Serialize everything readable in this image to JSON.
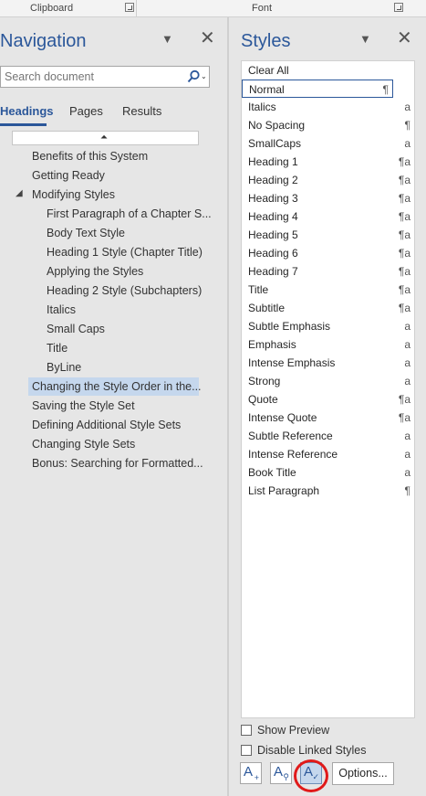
{
  "ribbon": {
    "clipboard_label": "Clipboard",
    "font_label": "Font"
  },
  "navigation": {
    "title": "Navigation",
    "search": {
      "placeholder": "Search document",
      "value": ""
    },
    "tabs": [
      {
        "label": "Headings"
      },
      {
        "label": "Pages"
      },
      {
        "label": "Results"
      }
    ],
    "headings": [
      {
        "label": "Benefits of this System"
      },
      {
        "label": "Getting Ready"
      },
      {
        "label": "Modifying Styles"
      },
      {
        "label": "First Paragraph of a Chapter S..."
      },
      {
        "label": "Body Text Style"
      },
      {
        "label": "Heading 1 Style (Chapter Title)"
      },
      {
        "label": "Applying the Styles"
      },
      {
        "label": "Heading 2 Style (Subchapters)"
      },
      {
        "label": "Italics"
      },
      {
        "label": "Small Caps"
      },
      {
        "label": "Title"
      },
      {
        "label": "ByLine"
      },
      {
        "label": "Changing the Style Order in the..."
      },
      {
        "label": "Saving the Style Set"
      },
      {
        "label": "Defining Additional Style Sets"
      },
      {
        "label": "Changing Style Sets"
      },
      {
        "label": "Bonus: Searching for Formatted..."
      }
    ]
  },
  "styles": {
    "title": "Styles",
    "items": [
      {
        "name": "Clear All",
        "type": ""
      },
      {
        "name": "Normal",
        "type": "¶"
      },
      {
        "name": "Italics",
        "type": "a"
      },
      {
        "name": "No Spacing",
        "type": "¶"
      },
      {
        "name": "SmallCaps",
        "type": "a"
      },
      {
        "name": "Heading 1",
        "type": "¶a"
      },
      {
        "name": "Heading 2",
        "type": "¶a"
      },
      {
        "name": "Heading 3",
        "type": "¶a"
      },
      {
        "name": "Heading 4",
        "type": "¶a"
      },
      {
        "name": "Heading 5",
        "type": "¶a"
      },
      {
        "name": "Heading 6",
        "type": "¶a"
      },
      {
        "name": "Heading 7",
        "type": "¶a"
      },
      {
        "name": "Title",
        "type": "¶a"
      },
      {
        "name": "Subtitle",
        "type": "¶a"
      },
      {
        "name": "Subtle Emphasis",
        "type": "a"
      },
      {
        "name": "Emphasis",
        "type": "a"
      },
      {
        "name": "Intense Emphasis",
        "type": "a"
      },
      {
        "name": "Strong",
        "type": "a"
      },
      {
        "name": "Quote",
        "type": "¶a"
      },
      {
        "name": "Intense Quote",
        "type": "¶a"
      },
      {
        "name": "Subtle Reference",
        "type": "a"
      },
      {
        "name": "Intense Reference",
        "type": "a"
      },
      {
        "name": "Book Title",
        "type": "a"
      },
      {
        "name": "List Paragraph",
        "type": "¶"
      }
    ],
    "show_preview_label": "Show Preview",
    "disable_linked_label": "Disable Linked Styles",
    "options_label": "Options..."
  },
  "colors": {
    "accent": "#2b579a",
    "selection": "#c5d7ed",
    "highlight_circle": "#e01a1a"
  }
}
